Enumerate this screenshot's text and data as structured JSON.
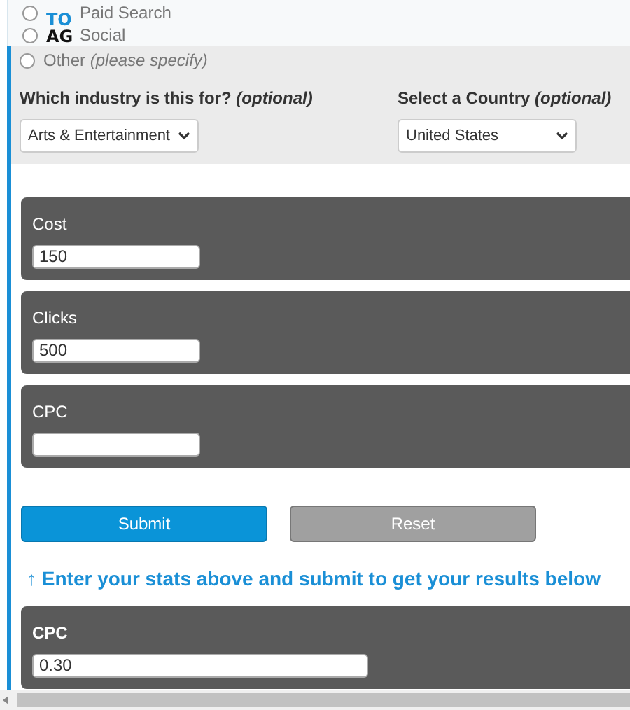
{
  "header": {
    "logo_top": "TO",
    "logo_bottom": "AG"
  },
  "channel_options": [
    {
      "label": "Paid Search",
      "selected": false
    },
    {
      "label": "Social",
      "selected": false
    },
    {
      "label": "Other *(please specify)*",
      "selected": false
    }
  ],
  "selects": [
    {
      "label": "Which industry is this for? *(optional)*",
      "value": "Arts & Entertainment"
    },
    {
      "label": "Select a Country *(optional)*",
      "value": "United States"
    }
  ],
  "inputs": [
    {
      "label": "Cost",
      "value": "150"
    },
    {
      "label": "Clicks",
      "value": "500"
    },
    {
      "label": "CPC"
    }
  ],
  "buttons": [
    {
      "label": "Submit",
      "kind": "primary"
    },
    {
      "label": "Reset",
      "kind": "secondary"
    }
  ],
  "message": "↑ Enter your stats above and submit to get your results below",
  "result": {
    "label": "CPC",
    "value": "0.30"
  }
}
